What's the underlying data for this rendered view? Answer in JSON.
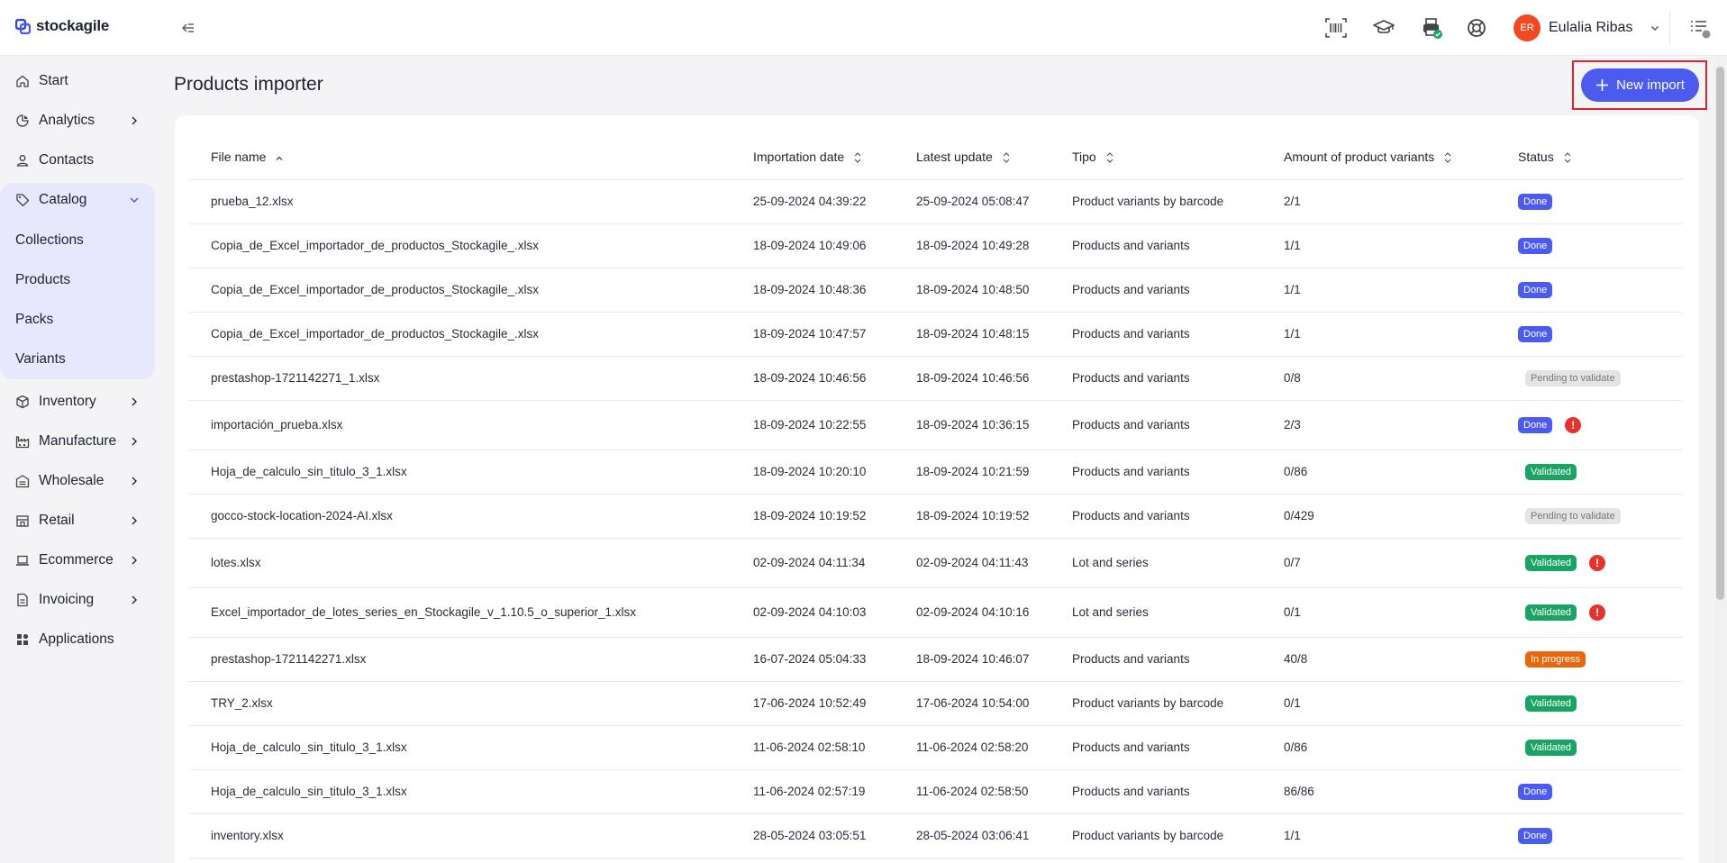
{
  "app": {
    "brand": "stockagile"
  },
  "user": {
    "initials": "ER",
    "name": "Eulalia Ribas"
  },
  "colors": {
    "accent": "#4b5bf0",
    "done": "#4b5bf0",
    "validated": "#19a463",
    "pending": "#e4e4e7",
    "in_progress": "#e9680e",
    "warning": "#e5322c"
  },
  "sidebar": {
    "items": [
      {
        "label": "Start",
        "icon": "home-icon"
      },
      {
        "label": "Analytics",
        "icon": "analytics-icon"
      },
      {
        "label": "Contacts",
        "icon": "user-icon"
      },
      {
        "label": "Catalog",
        "icon": "tag-icon"
      },
      {
        "label": "Inventory",
        "icon": "box-icon"
      },
      {
        "label": "Manufacture",
        "icon": "factory-icon"
      },
      {
        "label": "Wholesale",
        "icon": "warehouse-icon"
      },
      {
        "label": "Retail",
        "icon": "store-icon"
      },
      {
        "label": "Ecommerce",
        "icon": "laptop-icon"
      },
      {
        "label": "Invoicing",
        "icon": "invoice-icon"
      },
      {
        "label": "Applications",
        "icon": "apps-icon"
      }
    ],
    "catalog_sub": [
      "Collections",
      "Products",
      "Packs",
      "Variants"
    ]
  },
  "main": {
    "title": "Products importer",
    "new_import_label": "New import",
    "columns": [
      "File name",
      "Importation date",
      "Latest update",
      "Tipo",
      "Amount of product variants",
      "Status"
    ],
    "rows": [
      {
        "file": "prueba_12.xlsx",
        "imported": "25-09-2024 04:39:22",
        "updated": "25-09-2024 05:08:47",
        "type": "Product variants by barcode",
        "amount": "2/1",
        "status": "Done",
        "kind": "done",
        "warn": false
      },
      {
        "file": "Copia_de_Excel_importador_de_productos_Stockagile_.xlsx",
        "imported": "18-09-2024 10:49:06",
        "updated": "18-09-2024 10:49:28",
        "type": "Products and variants",
        "amount": "1/1",
        "status": "Done",
        "kind": "done",
        "warn": false
      },
      {
        "file": "Copia_de_Excel_importador_de_productos_Stockagile_.xlsx",
        "imported": "18-09-2024 10:48:36",
        "updated": "18-09-2024 10:48:50",
        "type": "Products and variants",
        "amount": "1/1",
        "status": "Done",
        "kind": "done",
        "warn": false
      },
      {
        "file": "Copia_de_Excel_importador_de_productos_Stockagile_.xlsx",
        "imported": "18-09-2024 10:47:57",
        "updated": "18-09-2024 10:48:15",
        "type": "Products and variants",
        "amount": "1/1",
        "status": "Done",
        "kind": "done",
        "warn": false
      },
      {
        "file": "prestashop-1721142271_1.xlsx",
        "imported": "18-09-2024 10:46:56",
        "updated": "18-09-2024 10:46:56",
        "type": "Products and variants",
        "amount": "0/8",
        "status": "Pending to validate",
        "kind": "pending",
        "warn": false
      },
      {
        "file": "importación_prueba.xlsx",
        "imported": "18-09-2024 10:22:55",
        "updated": "18-09-2024 10:36:15",
        "type": "Products and variants",
        "amount": "2/3",
        "status": "Done",
        "kind": "done",
        "warn": true
      },
      {
        "file": "Hoja_de_calculo_sin_titulo_3_1.xlsx",
        "imported": "18-09-2024 10:20:10",
        "updated": "18-09-2024 10:21:59",
        "type": "Products and variants",
        "amount": "0/86",
        "status": "Validated",
        "kind": "validated",
        "warn": false
      },
      {
        "file": "gocco-stock-location-2024-AI.xlsx",
        "imported": "18-09-2024 10:19:52",
        "updated": "18-09-2024 10:19:52",
        "type": "Products and variants",
        "amount": "0/429",
        "status": "Pending to validate",
        "kind": "pending",
        "warn": false
      },
      {
        "file": "lotes.xlsx",
        "imported": "02-09-2024 04:11:34",
        "updated": "02-09-2024 04:11:43",
        "type": "Lot and series",
        "amount": "0/7",
        "status": "Validated",
        "kind": "validated",
        "warn": true
      },
      {
        "file": "Excel_importador_de_lotes_series_en_Stockagile_v_1.10.5_o_superior_1.xlsx",
        "imported": "02-09-2024 04:10:03",
        "updated": "02-09-2024 04:10:16",
        "type": "Lot and series",
        "amount": "0/1",
        "status": "Validated",
        "kind": "validated",
        "warn": true
      },
      {
        "file": "prestashop-1721142271.xlsx",
        "imported": "16-07-2024 05:04:33",
        "updated": "18-09-2024 10:46:07",
        "type": "Products and variants",
        "amount": "40/8",
        "status": "In progress",
        "kind": "in_progress",
        "warn": false
      },
      {
        "file": "TRY_2.xlsx",
        "imported": "17-06-2024 10:52:49",
        "updated": "17-06-2024 10:54:00",
        "type": "Product variants by barcode",
        "amount": "0/1",
        "status": "Validated",
        "kind": "validated",
        "warn": false
      },
      {
        "file": "Hoja_de_calculo_sin_titulo_3_1.xlsx",
        "imported": "11-06-2024 02:58:10",
        "updated": "11-06-2024 02:58:20",
        "type": "Products and variants",
        "amount": "0/86",
        "status": "Validated",
        "kind": "validated",
        "warn": false
      },
      {
        "file": "Hoja_de_calculo_sin_titulo_3_1.xlsx",
        "imported": "11-06-2024 02:57:19",
        "updated": "11-06-2024 02:58:50",
        "type": "Products and variants",
        "amount": "86/86",
        "status": "Done",
        "kind": "done",
        "warn": false
      },
      {
        "file": "inventory.xlsx",
        "imported": "28-05-2024 03:05:51",
        "updated": "28-05-2024 03:06:41",
        "type": "Product variants by barcode",
        "amount": "1/1",
        "status": "Done",
        "kind": "done",
        "warn": false
      }
    ]
  }
}
